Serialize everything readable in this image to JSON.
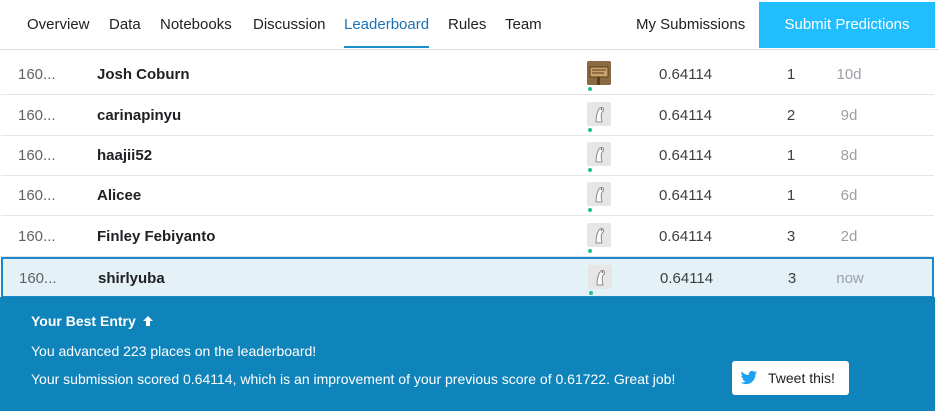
{
  "nav": {
    "tabs": [
      "Overview",
      "Data",
      "Notebooks",
      "Discussion",
      "Leaderboard",
      "Rules",
      "Team"
    ],
    "active_tab": "Leaderboard",
    "my_submissions": "My Submissions",
    "submit_predictions": "Submit Predictions"
  },
  "leaderboard": {
    "rows": [
      {
        "rank": "160...",
        "name": "Josh Coburn",
        "avatar": "wooden-sign-avatar",
        "score": "0.64114",
        "entries": "1",
        "last": "10d"
      },
      {
        "rank": "160...",
        "name": "carinapinyu",
        "avatar": "default-duck-avatar",
        "score": "0.64114",
        "entries": "2",
        "last": "9d"
      },
      {
        "rank": "160...",
        "name": "haajii52",
        "avatar": "default-duck-avatar",
        "score": "0.64114",
        "entries": "1",
        "last": "8d"
      },
      {
        "rank": "160...",
        "name": "Alicee",
        "avatar": "default-duck-avatar",
        "score": "0.64114",
        "entries": "1",
        "last": "6d"
      },
      {
        "rank": "160...",
        "name": "Finley Febiyanto",
        "avatar": "default-duck-avatar",
        "score": "0.64114",
        "entries": "3",
        "last": "2d"
      },
      {
        "rank": "160...",
        "name": "shirlyuba",
        "avatar": "default-duck-avatar",
        "score": "0.64114",
        "entries": "3",
        "last": "now",
        "is_current_user": true
      }
    ]
  },
  "best_entry": {
    "title": "Your Best Entry",
    "title_icon": "arrow-up-icon",
    "advanced_text": "You advanced 223 places on the leaderboard!",
    "score_text": "Your submission scored 0.64114, which is an improvement of your previous score of 0.61722. Great job!",
    "tweet_label": "Tweet this!",
    "tweet_icon": "twitter-bird-icon"
  },
  "colors": {
    "accent": "#20beff",
    "banner": "#0f84bb",
    "active_tab": "#1a73b8",
    "highlight_row": "#e4f1f6",
    "online_dot": "#1fbf8f"
  }
}
